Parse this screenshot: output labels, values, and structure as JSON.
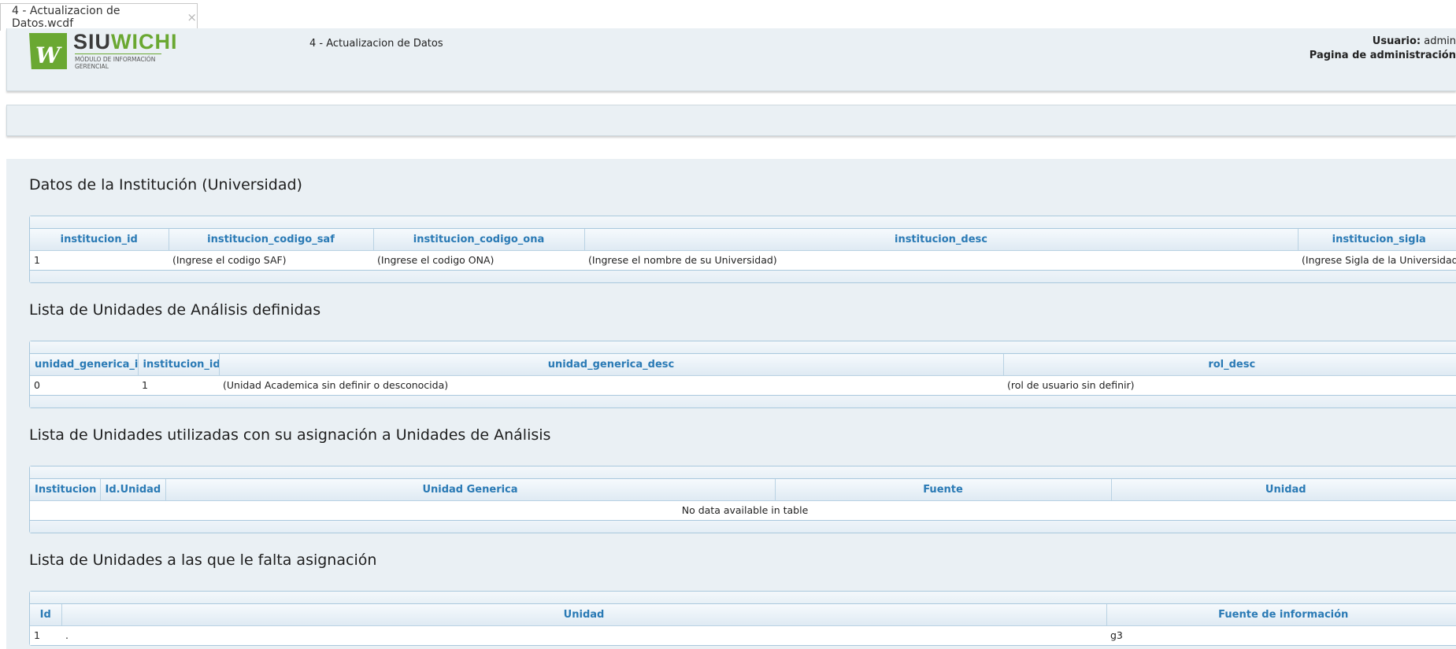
{
  "tab": {
    "title": "4 - Actualizacion de Datos.wcdf",
    "close_glyph": "×"
  },
  "header": {
    "logo": {
      "siu": "SIU",
      "wichi": "WICHI",
      "sub": "MÓDULO DE INFORMACIÓN GERENCIAL",
      "mark": "W"
    },
    "title": "4 - Actualizacion de Datos",
    "user_label": "Usuario:",
    "user_name": "admin",
    "admin_link": "Pagina de administración"
  },
  "sections": {
    "institucion": {
      "title": "Datos de la Institución (Universidad)",
      "columns": [
        "institucion_id",
        "institucion_codigo_saf",
        "institucion_codigo_ona",
        "institucion_desc",
        "institucion_sigla"
      ],
      "rows": [
        [
          "1",
          "(Ingrese el codigo SAF)",
          "(Ingrese el codigo ONA)",
          "(Ingrese el nombre de su Universidad)",
          "(Ingrese Sigla de la Universidad)"
        ]
      ]
    },
    "unidades_analisis": {
      "title": "Lista de Unidades de Análisis definidas",
      "columns": [
        "unidad_generica_id",
        "institucion_id",
        "unidad_generica_desc",
        "rol_desc"
      ],
      "rows": [
        [
          "0",
          "1",
          "(Unidad Academica sin definir o desconocida)",
          "(rol de usuario sin definir)"
        ]
      ]
    },
    "unidades_utilizadas": {
      "title": "Lista de Unidades utilizadas con su asignación a Unidades de Análisis",
      "columns": [
        "Institucion",
        "Id.Unidad",
        "Unidad Generica",
        "Fuente",
        "Unidad"
      ],
      "empty_message": "No data available in table"
    },
    "unidades_falta": {
      "title": "Lista de Unidades a las que le falta asignación",
      "columns": [
        "Id",
        "Unidad",
        "Fuente de información"
      ],
      "rows": [
        [
          "1",
          ".",
          "g3"
        ]
      ]
    }
  },
  "colors": {
    "accent": "#2a7ab5",
    "brand_green": "#6aa832",
    "panel": "#eaf0f4"
  }
}
